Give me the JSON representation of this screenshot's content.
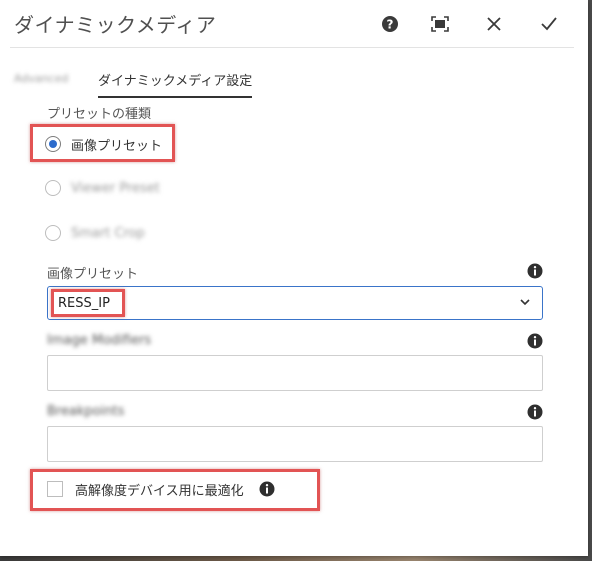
{
  "dialog": {
    "title": "ダイナミックメディア",
    "header_icons": [
      "help-icon",
      "fullscreen-icon",
      "close-icon",
      "done-icon"
    ]
  },
  "tabs": [
    {
      "label": "Advanced",
      "active": false
    },
    {
      "label": "ダイナミックメディア設定",
      "active": true
    }
  ],
  "preset_type": {
    "label": "プリセットの種類",
    "options": [
      {
        "label": "画像プリセット",
        "selected": true
      },
      {
        "label": "Viewer Preset",
        "selected": false
      },
      {
        "label": "Smart Crop",
        "selected": false
      }
    ]
  },
  "image_preset": {
    "label": "画像プリセット",
    "value": "RESS_IP"
  },
  "image_modifiers": {
    "label": "Image Modifiers",
    "value": ""
  },
  "breakpoints": {
    "label": "Breakpoints",
    "value": ""
  },
  "optimize_checkbox": {
    "label": "高解像度デバイス用に最適化",
    "checked": false
  },
  "colors": {
    "accent": "#2d6ccc",
    "highlight": "#e25454"
  }
}
